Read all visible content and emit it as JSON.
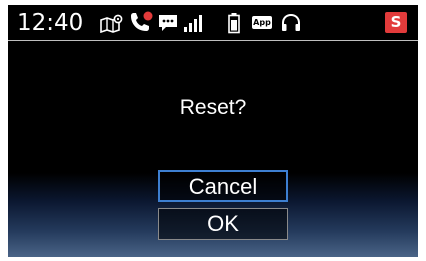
{
  "status_bar": {
    "time": "12:40",
    "app_badge": "App",
    "s_badge": "S",
    "icons": [
      "map-icon",
      "missed-call-icon",
      "message-icon",
      "signal-icon",
      "battery-icon",
      "app-icon",
      "headset-icon",
      "s-icon"
    ]
  },
  "dialog": {
    "prompt": "Reset?",
    "cancel_label": "Cancel",
    "ok_label": "OK",
    "focused": "Cancel"
  },
  "colors": {
    "background": "#000000",
    "text": "#ffffff",
    "focus_border": "#3d7fd1",
    "button_border": "#8a8a8a",
    "missed_call_dot": "#e23b3b",
    "s_badge": "#e23b3b"
  }
}
